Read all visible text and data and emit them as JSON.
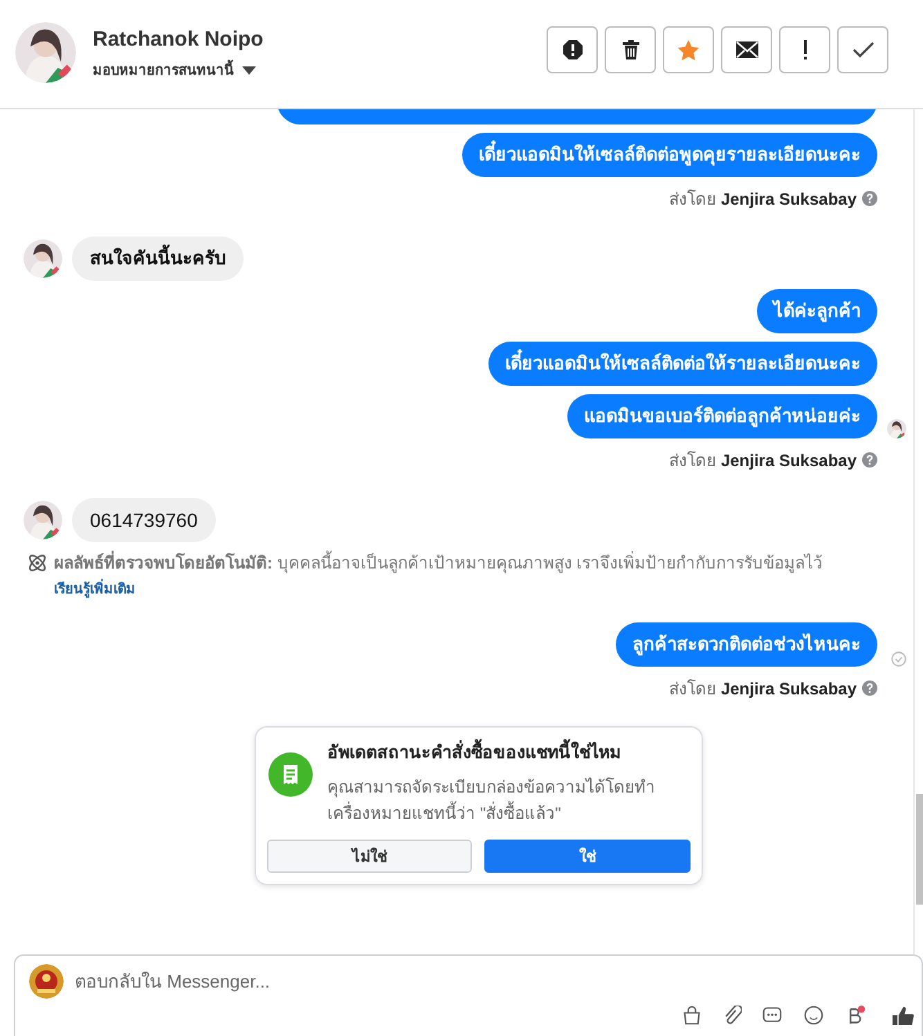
{
  "contact": {
    "name": "Ratchanok Noipo",
    "assign_label": "มอบหมายการสนทนานี้"
  },
  "messages": [
    {
      "kind": "cut"
    },
    {
      "kind": "outgoing",
      "text": "เดี๋ยวแอดมินให้เซลล์ติดต่อพูดคุยรายละเอียดนะคะ",
      "seen": false,
      "delivered": false
    },
    {
      "kind": "sent_by",
      "label": "ส่งโดย",
      "sender": "Jenjira Suksabay"
    },
    {
      "kind": "incoming",
      "text": "สนใจคันนี้นะครับ"
    },
    {
      "kind": "outgoing",
      "text": "ได้ค่ะลูกค้า",
      "seen": false,
      "delivered": false
    },
    {
      "kind": "outgoing",
      "text": "เดี๋ยวแอดมินให้เซลล์ติดต่อให้รายละเอียดนะคะ",
      "seen": false,
      "delivered": false
    },
    {
      "kind": "outgoing",
      "text": "แอดมินขอเบอร์ติดต่อลูกค้าหน่อยค่ะ",
      "seen": true,
      "delivered": false
    },
    {
      "kind": "sent_by",
      "label": "ส่งโดย",
      "sender": "Jenjira Suksabay"
    },
    {
      "kind": "incoming",
      "text": "0614739760"
    },
    {
      "kind": "notice",
      "label": "ผลลัพธ์ที่ตรวจพบโดยอัตโนมัติ:",
      "text": "บุคคลนี้อาจเป็นลูกค้าเป้าหมายคุณภาพสูง เราจึงเพิ่มป้ายกำกับการรับข้อมูลไว้",
      "link": "เรียนรู้เพิ่มเติม"
    },
    {
      "kind": "outgoing",
      "text": "ลูกค้าสะดวกติดต่อช่วงไหนคะ",
      "seen": false,
      "delivered": true
    },
    {
      "kind": "sent_by",
      "label": "ส่งโดย",
      "sender": "Jenjira Suksabay"
    },
    {
      "kind": "prompt",
      "title": "อัพเดตสถานะคำสั่งซื้อของแชทนี้ใช่ไหม",
      "text": "คุณสามารถจัดระเบียบกล่องข้อความได้โดยทำเครื่องหมายแชทนี้ว่า \"สั่งซื้อแล้ว\"",
      "buttons": [
        "ไม่ใช่",
        "ใช่"
      ]
    }
  ],
  "composer": {
    "placeholder": "ตอบกลับใน Messenger..."
  }
}
